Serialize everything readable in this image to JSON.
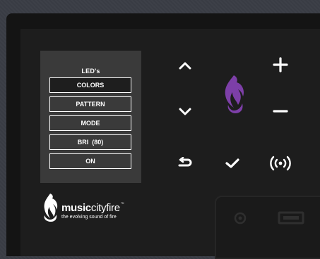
{
  "menu": {
    "title": "LED's",
    "items": [
      {
        "label": "COLORS",
        "active": true
      },
      {
        "label": "PATTERN",
        "active": false
      },
      {
        "label": "MODE",
        "active": false
      },
      {
        "label": "BRI  (80)",
        "active": false
      },
      {
        "label": "ON",
        "active": false
      }
    ]
  },
  "controls": {
    "up": "chevron-up-icon",
    "down": "chevron-down-icon",
    "back": "return-arrow-icon",
    "confirm": "checkmark-icon",
    "plus": "plus-icon",
    "minus": "minus-icon",
    "remote": "wireless-signal-icon",
    "flame": "flame-logo-icon"
  },
  "brand": {
    "name_bold": "music",
    "name_light": "cityfire",
    "trademark": "™",
    "tagline": "the evolving sound of fire"
  },
  "colors": {
    "flame": "#7d3fa8",
    "text": "#ffffff",
    "panel": "#1d1d1d",
    "menu_bg": "#3a3a3a"
  }
}
